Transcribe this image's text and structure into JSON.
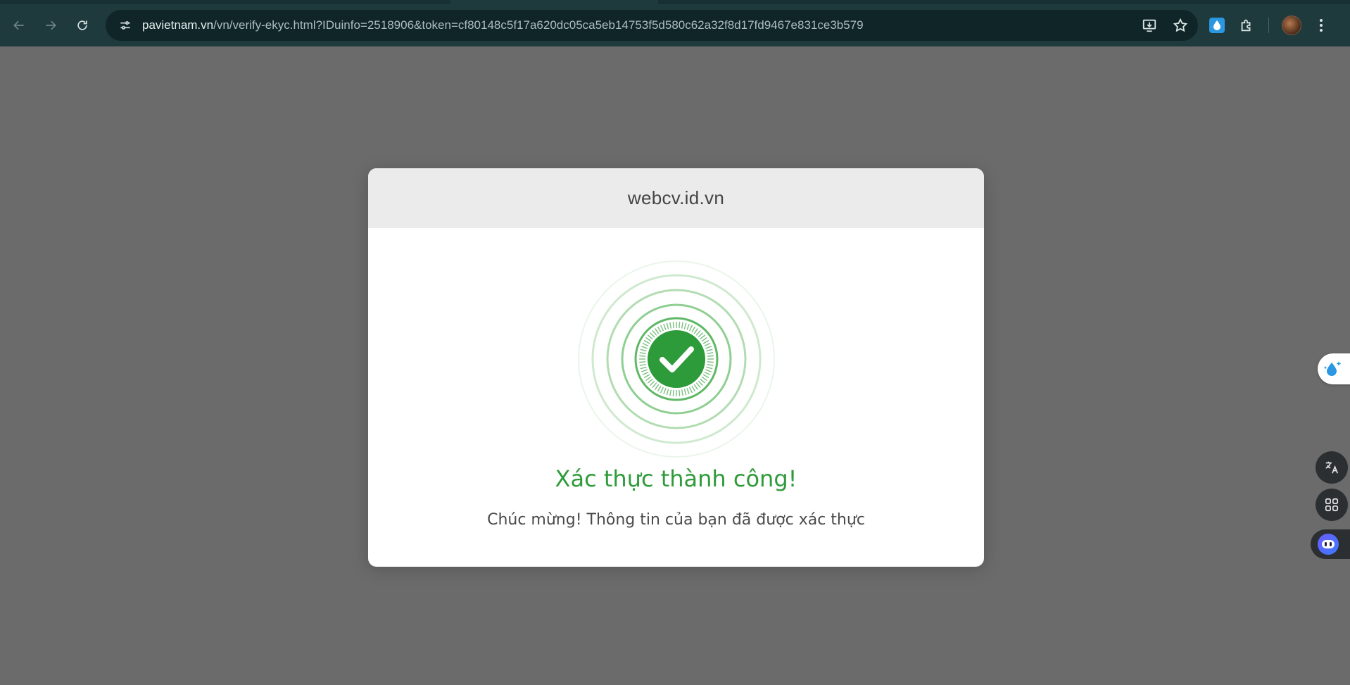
{
  "browser": {
    "url_host": "pavietnam.vn",
    "url_rest": "/vn/verify-ekyc.html?IDuinfo=2518906&token=cf80148c5f17a620dc05ca5eb14753f5d580c62a32f8d17fd9467e831ce3b579",
    "icons": [
      "back-icon",
      "forward-icon",
      "reload-icon",
      "site-info-icon",
      "install-app-icon",
      "bookmark-star-icon",
      "extension-drop-icon",
      "extensions-puzzle-icon",
      "profile-avatar",
      "menu-kebab-icon"
    ]
  },
  "modal": {
    "title": "webcv.id.vn",
    "heading": "Xác thực thành công!",
    "message": "Chúc mừng! Thông tin của bạn đã được xác thực"
  },
  "floating_widgets": {
    "icons": [
      "drop-sparkle-icon",
      "translate-icon",
      "apps-grid-icon",
      "assistant-bot-icon"
    ]
  },
  "colors": {
    "success_green": "#2f9b3a",
    "overlay": "#6b6b6b",
    "toolbar": "#1f3a3d"
  }
}
